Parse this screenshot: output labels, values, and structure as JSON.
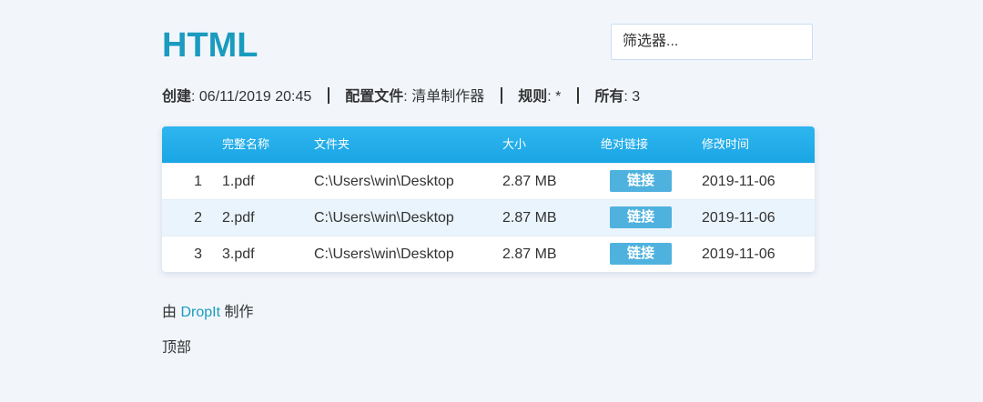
{
  "header": {
    "title": "HTML",
    "filter_placeholder": "筛选器..."
  },
  "meta": {
    "created_label": "创建",
    "created_value": "06/11/2019 20:45",
    "profile_label": "配置文件",
    "profile_value": "清单制作器",
    "rule_label": "规则",
    "rule_value": "*",
    "total_label": "所有",
    "total_value": "3"
  },
  "table": {
    "columns": [
      "完整名称",
      "文件夹",
      "大小",
      "绝对链接",
      "修改时间"
    ],
    "rows": [
      {
        "index": "1",
        "name": "1.pdf",
        "folder": "C:\\Users\\win\\Desktop",
        "size": "2.87 MB",
        "link": "链接",
        "modified": "2019-11-06"
      },
      {
        "index": "2",
        "name": "2.pdf",
        "folder": "C:\\Users\\win\\Desktop",
        "size": "2.87 MB",
        "link": "链接",
        "modified": "2019-11-06"
      },
      {
        "index": "3",
        "name": "3.pdf",
        "folder": "C:\\Users\\win\\Desktop",
        "size": "2.87 MB",
        "link": "链接",
        "modified": "2019-11-06"
      }
    ]
  },
  "footer": {
    "made_by_prefix": "由",
    "made_by_link": "DropIt",
    "made_by_suffix": "制作",
    "top_link": "顶部"
  },
  "colors": {
    "accent": "#1a9bbf",
    "header_bg": "#1aa5e4",
    "link_button_bg": "#4fb2de",
    "page_bg": "#f2f6fb",
    "alt_row_bg": "#eaf4fc"
  }
}
